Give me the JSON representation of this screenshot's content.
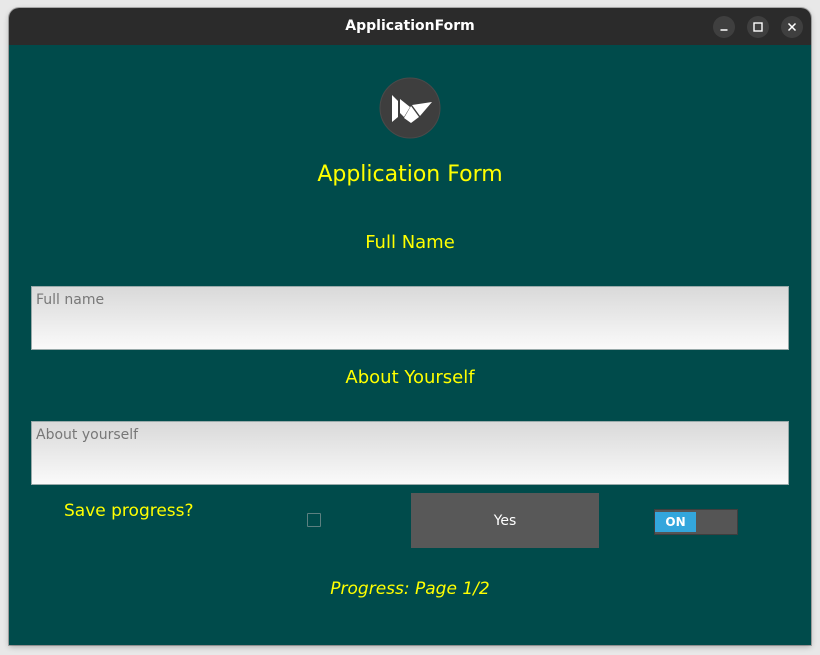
{
  "window": {
    "title": "ApplicationForm",
    "controls": [
      "minimize-icon",
      "maximize-icon",
      "close-icon"
    ]
  },
  "form": {
    "title": "Application Form",
    "full_name_label": "Full Name",
    "full_name_placeholder": "Full name",
    "about_label": "About Yourself",
    "about_placeholder": "About yourself",
    "save_progress_label": "Save progress?",
    "save_progress_checked": false,
    "yes_button_label": "Yes",
    "toggle_label": "ON",
    "toggle_on": true,
    "progress_text": "Progress: Page 1/2"
  },
  "colors": {
    "background": "#004b4b",
    "text_accent": "#ffff00",
    "button": "#585858",
    "toggle_on": "#33a6dc",
    "titlebar": "#2b2b2b"
  },
  "icons": {
    "logo": "kivy-logo-icon"
  }
}
